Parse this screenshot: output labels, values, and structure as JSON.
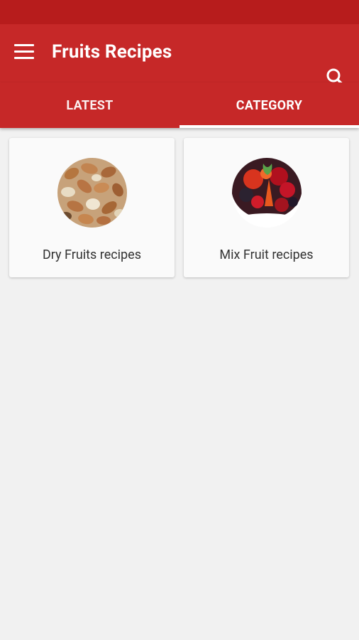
{
  "app": {
    "title": "Fruits Recipes",
    "theme_color": "#c62828",
    "status_color": "#b71c1c",
    "menu_icon": "hamburger-menu-icon",
    "search_icon": "search-icon"
  },
  "tabs": [
    {
      "label": "LATEST",
      "selected": false
    },
    {
      "label": "CATEGORY",
      "selected": true
    }
  ],
  "categories": [
    {
      "label": "Dry Fruits recipes",
      "image": "dry-fruits-nuts-photo"
    },
    {
      "label": "Mix Fruit recipes",
      "image": "mixed-berries-fruit-photo"
    }
  ]
}
